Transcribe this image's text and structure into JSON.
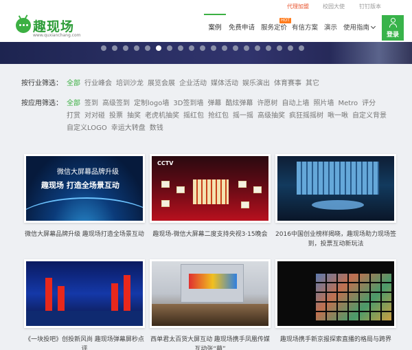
{
  "topnav": {
    "agent": "代理加盟",
    "campus": "校园大使",
    "dingding": "钉钉版本"
  },
  "logo": {
    "text": "趣现场",
    "url": "www.quxianchang.com"
  },
  "nav": {
    "items": [
      "案例",
      "免费申请",
      "服务定价",
      "有信方案",
      "演示",
      "使用指南"
    ],
    "hot_badge": "HOT"
  },
  "login": {
    "label": "登录"
  },
  "banner": {
    "dot_count": 19,
    "active_dot": 5
  },
  "filters": {
    "industry": {
      "label": "按行业筛选：",
      "items": [
        "全部",
        "行业峰会",
        "培训沙龙",
        "展览会展",
        "企业活动",
        "媒体活动",
        "娱乐演出",
        "体育赛事",
        "其它"
      ]
    },
    "application": {
      "label": "按应用筛选：",
      "items": [
        "全部",
        "签到",
        "高级签到",
        "定制logo墙",
        "3D签到墙",
        "弹幕",
        "酷炫弹幕",
        "许愿树",
        "自动上墙",
        "照片墙",
        "Metro",
        "评分",
        "打赏",
        "对对碰",
        "投票",
        "抽奖",
        "老虎机抽奖",
        "摇红包",
        "抢红包",
        "摇一摇",
        "高级抽奖",
        "疯狂摇摇树",
        "啾一啾",
        "自定义背景",
        "自定义LOGO",
        "幸运大转盘",
        "数钱"
      ]
    }
  },
  "cards": [
    {
      "caption": "微信大屏幕品牌升级 趣现场打造全场景互动",
      "thumb_line1": "微信大屏幕品牌升级",
      "thumb_line2": "趣现场 打造全场景互动"
    },
    {
      "caption": "趣现场-微信大屏幕二度支持央视3·15晚会",
      "thumb_label": "CCTV"
    },
    {
      "caption": "2016中国创业榜样揭晓，趣现场助力现场签到，投票互动新玩法"
    },
    {
      "caption": "《一块投吧》创投新风尚 趣现场弹幕屏秒点评"
    },
    {
      "caption": "西单君太百货大屏互动 趣现场携手凤凰传媒互动张“萌”"
    },
    {
      "caption": "趣现场携手新京报探索直播的格局与跨界"
    }
  ]
}
